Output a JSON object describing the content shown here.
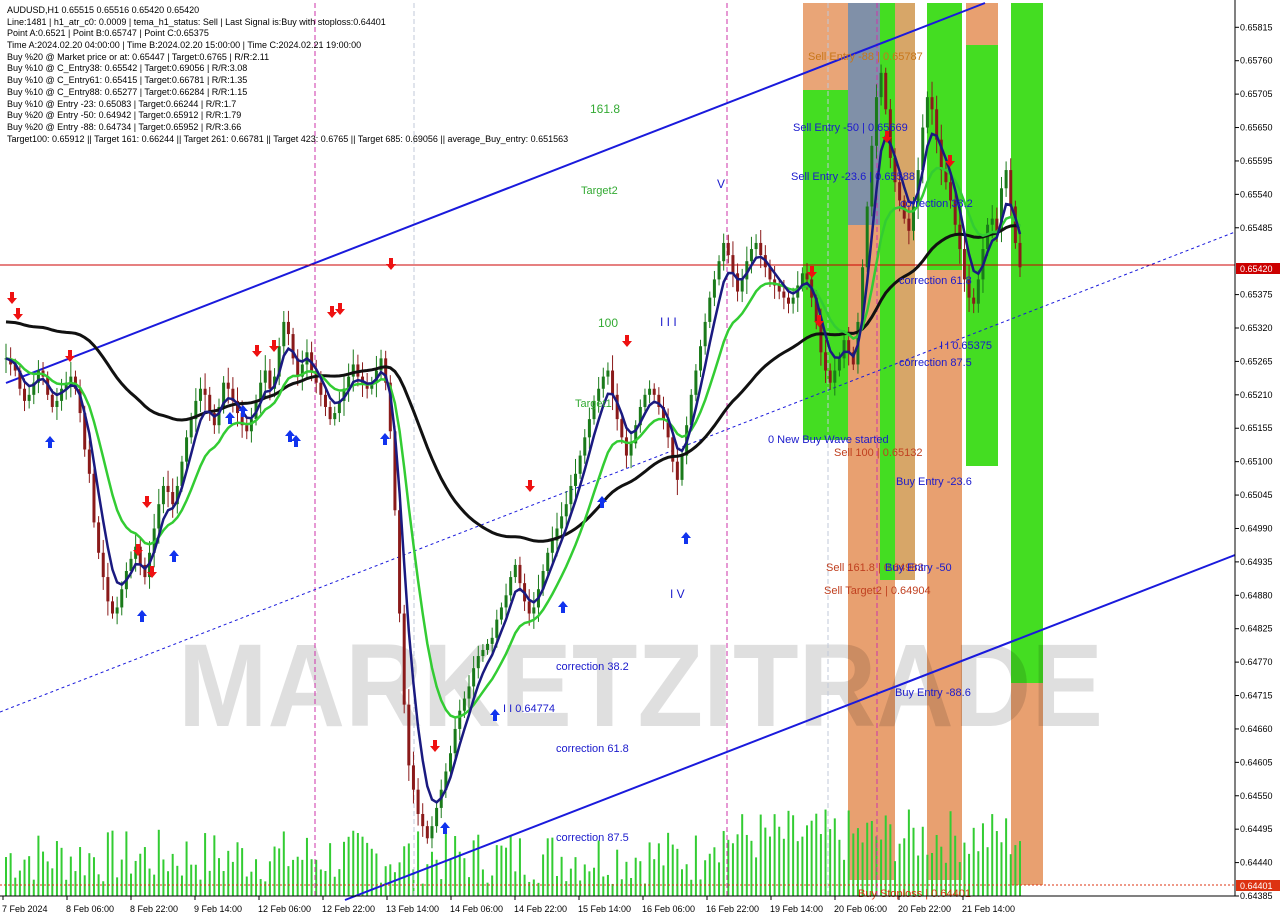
{
  "header": {
    "symbol_line": "AUDUSD,H1  0.65515 0.65516 0.65420 0.65420",
    "info_lines": [
      "Line:1481 | h1_atr_c0: 0.0009 | tema_h1_status: Sell | Last Signal is:Buy with stoploss:0.64401",
      "Point A:0.6521 | Point B:0.65747 | Point C:0.65375",
      "Time A:2024.02.20 04:00:00 | Time B:2024.02.20 15:00:00 | Time C:2024.02.21 19:00:00",
      "Buy %20 @ Market price or at: 0.65447 | Target:0.6765 | R/R:2.11",
      "Buy %10 @ C_Entry38: 0.65542 | Target:0.69056 | R/R:3.08",
      "Buy %10 @ C_Entry61: 0.65415 | Target:0.66781 | R/R:1.35",
      "Buy %10 @ C_Entry88: 0.65277 | Target:0.66284 | R/R:1.15",
      "Buy %10 @ Entry -23: 0.65083 | Target:0.66244 | R/R:1.7",
      "Buy %20 @ Entry -50: 0.64942 | Target:0.65912 | R/R:1.79",
      "Buy %20 @ Entry -88: 0.64734 | Target:0.65952 | R/R:3.66",
      "Target100: 0.65912 || Target 161: 0.66244 || Target 261: 0.66781 || Target 423: 0.6765 || Target 685: 0.69056 || average_Buy_entry: 0.651563"
    ]
  },
  "watermark": "MARKETZITRADE",
  "colors": {
    "blue_channel": "#1a1adc",
    "tema": "#1a1a80",
    "ma_green": "#33cc33",
    "ma_black": "#111111",
    "bull_candle": "#1a7a1a",
    "bear_candle": "#8a1a1a",
    "current_price": "#cc0000",
    "green_zone": "#44dd22",
    "orange_zone": "#e8a070",
    "grey_zone": "#8090a8"
  },
  "chart_data": {
    "type": "candlestick",
    "symbol": "AUDUSD",
    "timeframe": "H1",
    "ylim": [
      0.64385,
      0.65855
    ],
    "y_ticks": [
      "0.65815",
      "0.65760",
      "0.65705",
      "0.65650",
      "0.65595",
      "0.65540",
      "0.65485",
      "0.65375",
      "0.65320",
      "0.65265",
      "0.65210",
      "0.65155",
      "0.65100",
      "0.65045",
      "0.64990",
      "0.64935",
      "0.64880",
      "0.64825",
      "0.64770",
      "0.64715",
      "0.64660",
      "0.64605",
      "0.64550",
      "0.64495",
      "0.64440",
      "0.64385"
    ],
    "current_price": "0.65420",
    "stoploss_price": "0.64401",
    "x_ticks": [
      "7 Feb 2024",
      "8 Feb 06:00",
      "8 Feb 22:00",
      "9 Feb 14:00",
      "12 Feb 06:00",
      "12 Feb 22:00",
      "13 Feb 14:00",
      "14 Feb 06:00",
      "14 Feb 22:00",
      "15 Feb 14:00",
      "16 Feb 06:00",
      "16 Feb 22:00",
      "19 Feb 14:00",
      "20 Feb 06:00",
      "20 Feb 22:00",
      "21 Feb 14:00"
    ],
    "close_series": [
      0.6527,
      0.6526,
      0.6525,
      0.6522,
      0.652,
      0.6521,
      0.6523,
      0.6525,
      0.6524,
      0.6521,
      0.6519,
      0.652,
      0.6522,
      0.6523,
      0.6524,
      0.6522,
      0.6518,
      0.6512,
      0.6508,
      0.65,
      0.6495,
      0.6491,
      0.6487,
      0.6485,
      0.6486,
      0.6489,
      0.6492,
      0.6494,
      0.6496,
      0.6493,
      0.6491,
      0.6495,
      0.6499,
      0.6503,
      0.6506,
      0.6505,
      0.6503,
      0.6506,
      0.651,
      0.6514,
      0.6517,
      0.652,
      0.6522,
      0.6521,
      0.6518,
      0.6516,
      0.6519,
      0.6523,
      0.6522,
      0.652,
      0.6518,
      0.6516,
      0.6515,
      0.6517,
      0.652,
      0.6523,
      0.6525,
      0.6522,
      0.6524,
      0.6529,
      0.6533,
      0.6531,
      0.6527,
      0.6524,
      0.6526,
      0.6528,
      0.6525,
      0.6523,
      0.6521,
      0.6519,
      0.6517,
      0.6518,
      0.652,
      0.6522,
      0.6524,
      0.6526,
      0.6524,
      0.6523,
      0.6522,
      0.6523,
      0.6525,
      0.6527,
      0.6523,
      0.6515,
      0.6502,
      0.6485,
      0.647,
      0.646,
      0.6456,
      0.6452,
      0.645,
      0.6448,
      0.645,
      0.6453,
      0.6456,
      0.6459,
      0.6462,
      0.6466,
      0.6469,
      0.6471,
      0.6473,
      0.6476,
      0.6478,
      0.6479,
      0.648,
      0.6481,
      0.6484,
      0.6486,
      0.6488,
      0.6491,
      0.6493,
      0.649,
      0.6487,
      0.6485,
      0.6486,
      0.6489,
      0.6492,
      0.6495,
      0.6497,
      0.6499,
      0.6501,
      0.6503,
      0.6506,
      0.6508,
      0.6511,
      0.6514,
      0.6517,
      0.652,
      0.6522,
      0.6524,
      0.6525,
      0.6521,
      0.6517,
      0.6514,
      0.6511,
      0.6513,
      0.6516,
      0.6519,
      0.6521,
      0.6522,
      0.6521,
      0.6519,
      0.6517,
      0.6514,
      0.651,
      0.6507,
      0.6511,
      0.6516,
      0.6521,
      0.6525,
      0.6529,
      0.6533,
      0.6537,
      0.654,
      0.6543,
      0.6546,
      0.6544,
      0.6541,
      0.6538,
      0.654,
      0.6543,
      0.6545,
      0.6546,
      0.6544,
      0.6542,
      0.654,
      0.6539,
      0.6538,
      0.6537,
      0.6536,
      0.6537,
      0.6539,
      0.6541,
      0.654,
      0.6537,
      0.6533,
      0.6528,
      0.6525,
      0.6523,
      0.6525,
      0.6527,
      0.653,
      0.6528,
      0.6526,
      0.6533,
      0.6542,
      0.6552,
      0.6562,
      0.657,
      0.6574,
      0.6568,
      0.656,
      0.6556,
      0.6553,
      0.655,
      0.6548,
      0.6552,
      0.6558,
      0.6565,
      0.657,
      0.6568,
      0.6563,
      0.6558,
      0.6556,
      0.6553,
      0.6549,
      0.6545,
      0.654,
      0.6537,
      0.6536,
      0.654,
      0.6545,
      0.6549,
      0.655,
      0.6548,
      0.6555,
      0.6558,
      0.6552,
      0.6546,
      0.6542
    ]
  }
}
